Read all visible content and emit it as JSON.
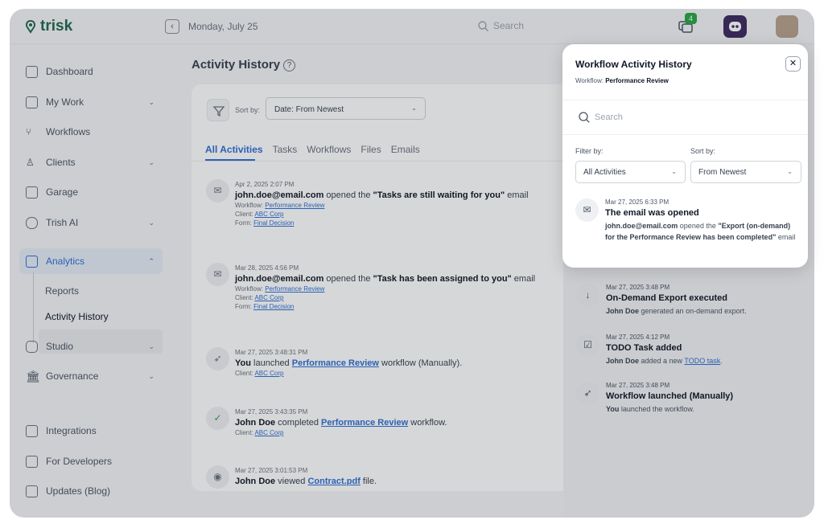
{
  "brand": {
    "name": "trisk"
  },
  "topbar": {
    "date": "Monday, July 25",
    "search_placeholder": "Search",
    "notifications_count": "4"
  },
  "sidebar": {
    "items": [
      {
        "label": "Dashboard"
      },
      {
        "label": "My Work"
      },
      {
        "label": "Workflows"
      },
      {
        "label": "Clients"
      },
      {
        "label": "Garage"
      },
      {
        "label": "Trish AI"
      },
      {
        "label": "Analytics"
      },
      {
        "label": "Studio"
      },
      {
        "label": "Governance"
      },
      {
        "label": "Integrations"
      },
      {
        "label": "For Developers"
      },
      {
        "label": "Updates (Blog)"
      }
    ],
    "analytics_sub": [
      {
        "label": "Reports"
      },
      {
        "label": "Activity History"
      }
    ]
  },
  "main": {
    "title": "Activity History",
    "sort_label": "Sort by:",
    "sort_value": "Date: From Newest",
    "tabs": [
      {
        "label": "All Activities"
      },
      {
        "label": "Tasks"
      },
      {
        "label": "Workflows"
      },
      {
        "label": "Files"
      },
      {
        "label": "Emails"
      }
    ],
    "entries": [
      {
        "ts": "Apr 2, 2025 2:07 PM",
        "actor": "john.doe@email.com",
        "verb": " opened the ",
        "object": "\"Tasks are still waiting for you\"",
        "tail": " email",
        "workflow_label": "Workflow: ",
        "workflow": "Performance Review",
        "client_label": "Client: ",
        "client": "ABC Corp",
        "form_label": "Form: ",
        "form": "Final Decision"
      },
      {
        "ts": "Mar 28, 2025 4:56 PM",
        "actor": "john.doe@email.com",
        "verb": " opened the ",
        "object": "\"Task has been assigned to you\"",
        "tail": " email",
        "workflow_label": "Workflow: ",
        "workflow": "Performance Review",
        "client_label": "Client: ",
        "client": "ABC Corp",
        "form_label": "Form: ",
        "form": "Final Decision"
      },
      {
        "ts": "Mar 27, 2025 3:48:31 PM",
        "actor": "You",
        "verb": " launched ",
        "object": "Performance Review",
        "tail": " workflow (Manually).",
        "client_label": "Client: ",
        "client": "ABC Corp"
      },
      {
        "ts": "Mar 27, 2025 3:43:35 PM",
        "actor": "John Doe",
        "verb": " completed ",
        "object": "Performance Review",
        "tail": " workflow.",
        "client_label": "Client: ",
        "client": "ABC Corp"
      },
      {
        "ts": "Mar 27, 2025 3:01:53 PM",
        "actor": "John Doe",
        "verb": " viewed ",
        "object": "Contract.pdf",
        "tail": " file."
      }
    ]
  },
  "popup": {
    "title": "Workflow Activity History",
    "workflow_label": "Workflow: ",
    "workflow": "Performance Review",
    "search_placeholder": "Search",
    "filter_label": "Filter by:",
    "filter_value": "All Activities",
    "sort_label": "Sort by:",
    "sort_value": "From Newest",
    "items": [
      {
        "ts": "Mar 27, 2025 6:33 PM",
        "title": "The email was opened",
        "actor": "john.doe@email.com",
        "verb": " opened the ",
        "object": "\"Export (on-demand) for the Performance Review has been completed\"",
        "tail": " email"
      },
      {
        "ts": "Mar 27, 2025 3:48 PM",
        "title": "On-Demand Export executed",
        "actor": "John Doe",
        "desc": " generated an on-demand export."
      },
      {
        "ts": "Mar 27, 2025 4:12 PM",
        "title": "TODO Task added",
        "actor": "John Doe",
        "desc": " added a new ",
        "link": "TODO task",
        "tail": "."
      },
      {
        "ts": "Mar 27, 2025 3:48 PM",
        "title": "Workflow launched (Manually)",
        "actor": "You",
        "desc": " launched the workflow."
      }
    ]
  },
  "colors": {
    "accent": "#2f6fd6",
    "brand": "#1e6a4e",
    "badge": "#28a745"
  }
}
